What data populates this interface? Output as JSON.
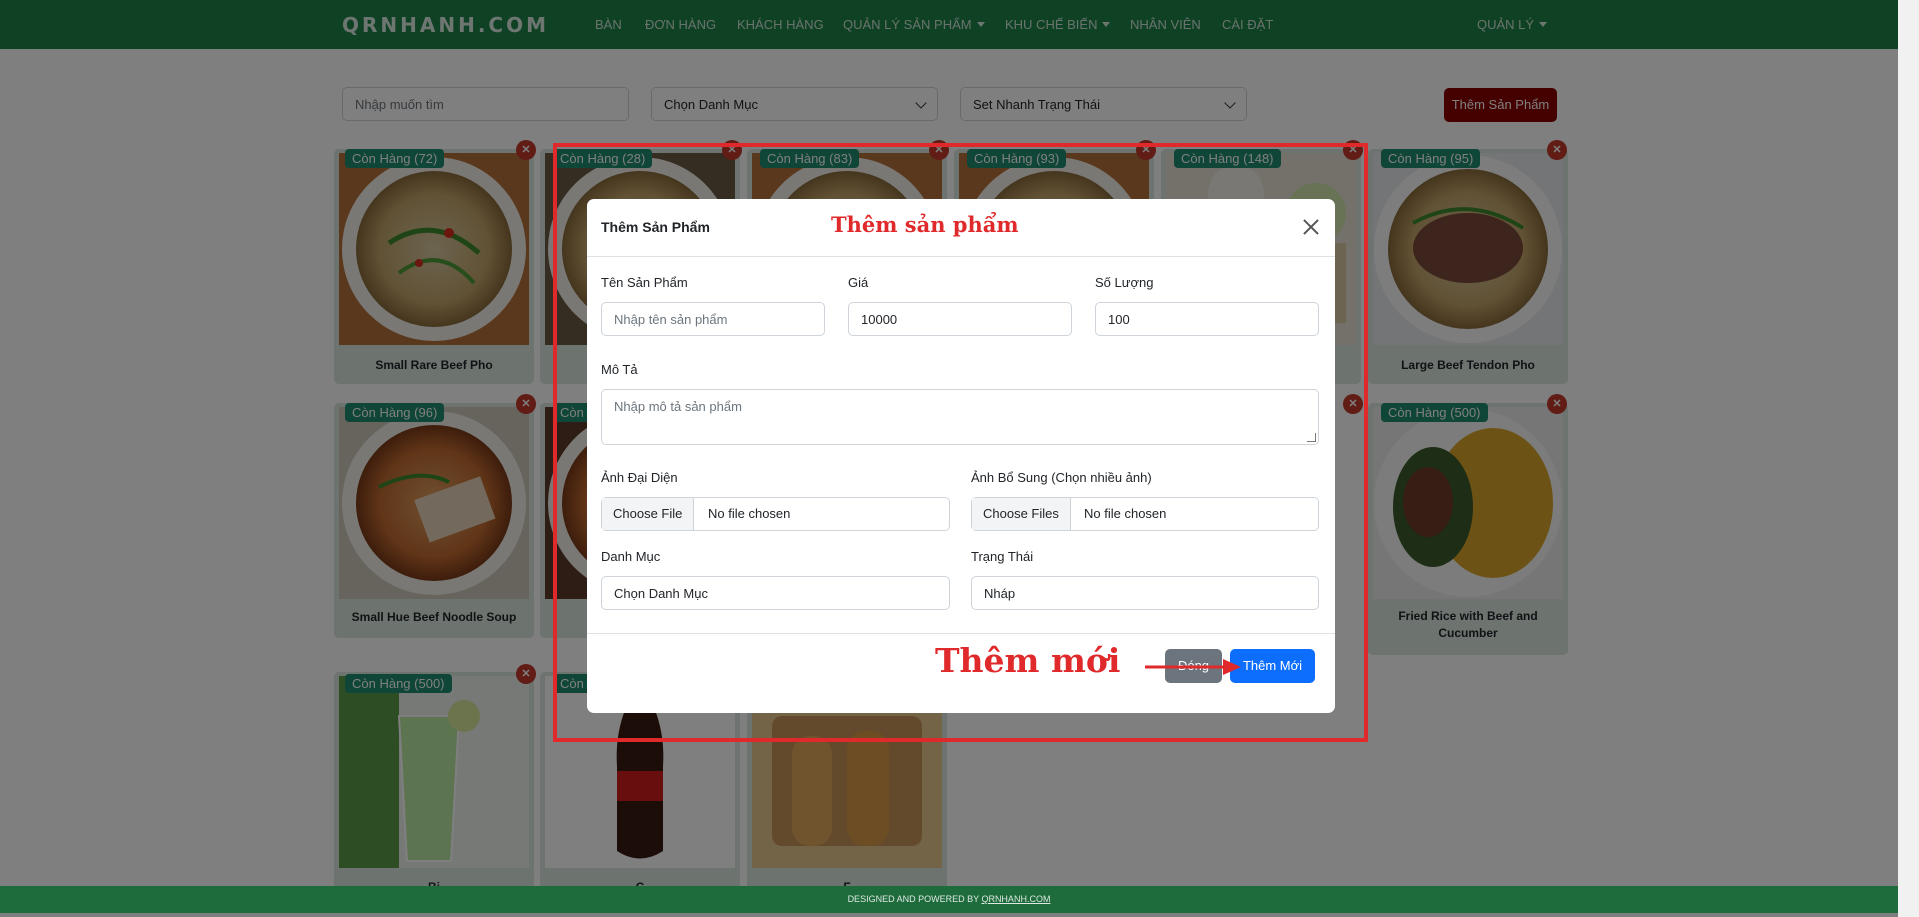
{
  "nav": {
    "brand": "QRNHANH.COM",
    "items": [
      {
        "label": "BÀN",
        "dropdown": false
      },
      {
        "label": "ĐƠN HÀNG",
        "dropdown": false
      },
      {
        "label": "KHÁCH HÀNG",
        "dropdown": false
      },
      {
        "label": "QUẢN LÝ SẢN PHẨM",
        "dropdown": true
      },
      {
        "label": "KHU CHẾ BIẾN",
        "dropdown": true
      },
      {
        "label": "NHÂN VIÊN",
        "dropdown": false
      },
      {
        "label": "CÀI ĐẶT",
        "dropdown": false
      }
    ],
    "account": "QUẢN LÝ"
  },
  "toolbar": {
    "search_placeholder": "Nhập muốn tìm",
    "category_select": "Chọn Danh Mục",
    "status_select": "Set Nhanh Trạng Thái",
    "add_button": "Thêm Sản Phẩm"
  },
  "products": [
    {
      "badge": "Còn Hàng (72)",
      "name": "Small Rare Beef Pho",
      "img": "pho-bowl"
    },
    {
      "badge": "Còn Hàng (28)",
      "name": "L",
      "img": "pho-bowl"
    },
    {
      "badge": "Còn Hàng (83)",
      "name": "",
      "img": "pho-bowl"
    },
    {
      "badge": "Còn Hàng (93)",
      "name": "",
      "img": "pho-bowl"
    },
    {
      "badge": "Còn Hàng (148)",
      "name": "",
      "img": "pho-table"
    },
    {
      "badge": "Còn Hàng (95)",
      "name": "Large Beef Tendon Pho",
      "img": "pho-bowl"
    },
    {
      "badge": "Còn Hàng (96)",
      "name": "Small Hue Beef Noodle Soup",
      "img": "bun-bo"
    },
    {
      "badge": "Còn",
      "name": "Big",
      "img": "bun-bo"
    },
    {
      "badge": "Còn Hàng (500)",
      "name": "Fried Rice with Beef and Cucumber",
      "img": "fried-rice"
    },
    {
      "badge": "Còn Hàng (500)",
      "name": "Bi",
      "img": "green-drink"
    },
    {
      "badge": "Còn",
      "name": "C",
      "img": "coke-bottle"
    },
    {
      "badge": "",
      "name": "F",
      "img": "bread-sticks"
    }
  ],
  "modal": {
    "title": "Thêm Sản Phẩm",
    "name_label": "Tên Sản Phẩm",
    "name_placeholder": "Nhập tên sản phẩm",
    "price_label": "Giá",
    "price_value": "10000",
    "qty_label": "Số Lượng",
    "qty_value": "100",
    "desc_label": "Mô Tả",
    "desc_placeholder": "Nhập mô tả sản phẩm",
    "avatar_label": "Ảnh Đại Diện",
    "avatar_button": "Choose File",
    "avatar_status": "No file chosen",
    "extra_label": "Ảnh Bổ Sung (Chọn nhiều ảnh)",
    "extra_button": "Choose Files",
    "extra_status": "No file chosen",
    "category_label": "Danh Mục",
    "category_value": "Chọn Danh Mục",
    "status_label": "Trạng Thái",
    "status_value": "Nháp",
    "close_button": "Đóng",
    "submit_button": "Thêm Mới"
  },
  "annotations": {
    "title": "Thêm sản phẩm",
    "submit_note": "Thêm mới"
  },
  "footer": {
    "prefix": "DESIGNED AND POWERED BY ",
    "link": "QRNHANH.COM"
  },
  "colors": {
    "navbar": "#1e8449",
    "badge": "#1e8c6e",
    "add_button": "#8b0000",
    "annotation_red": "#e0292b",
    "primary": "#0d6efd"
  }
}
